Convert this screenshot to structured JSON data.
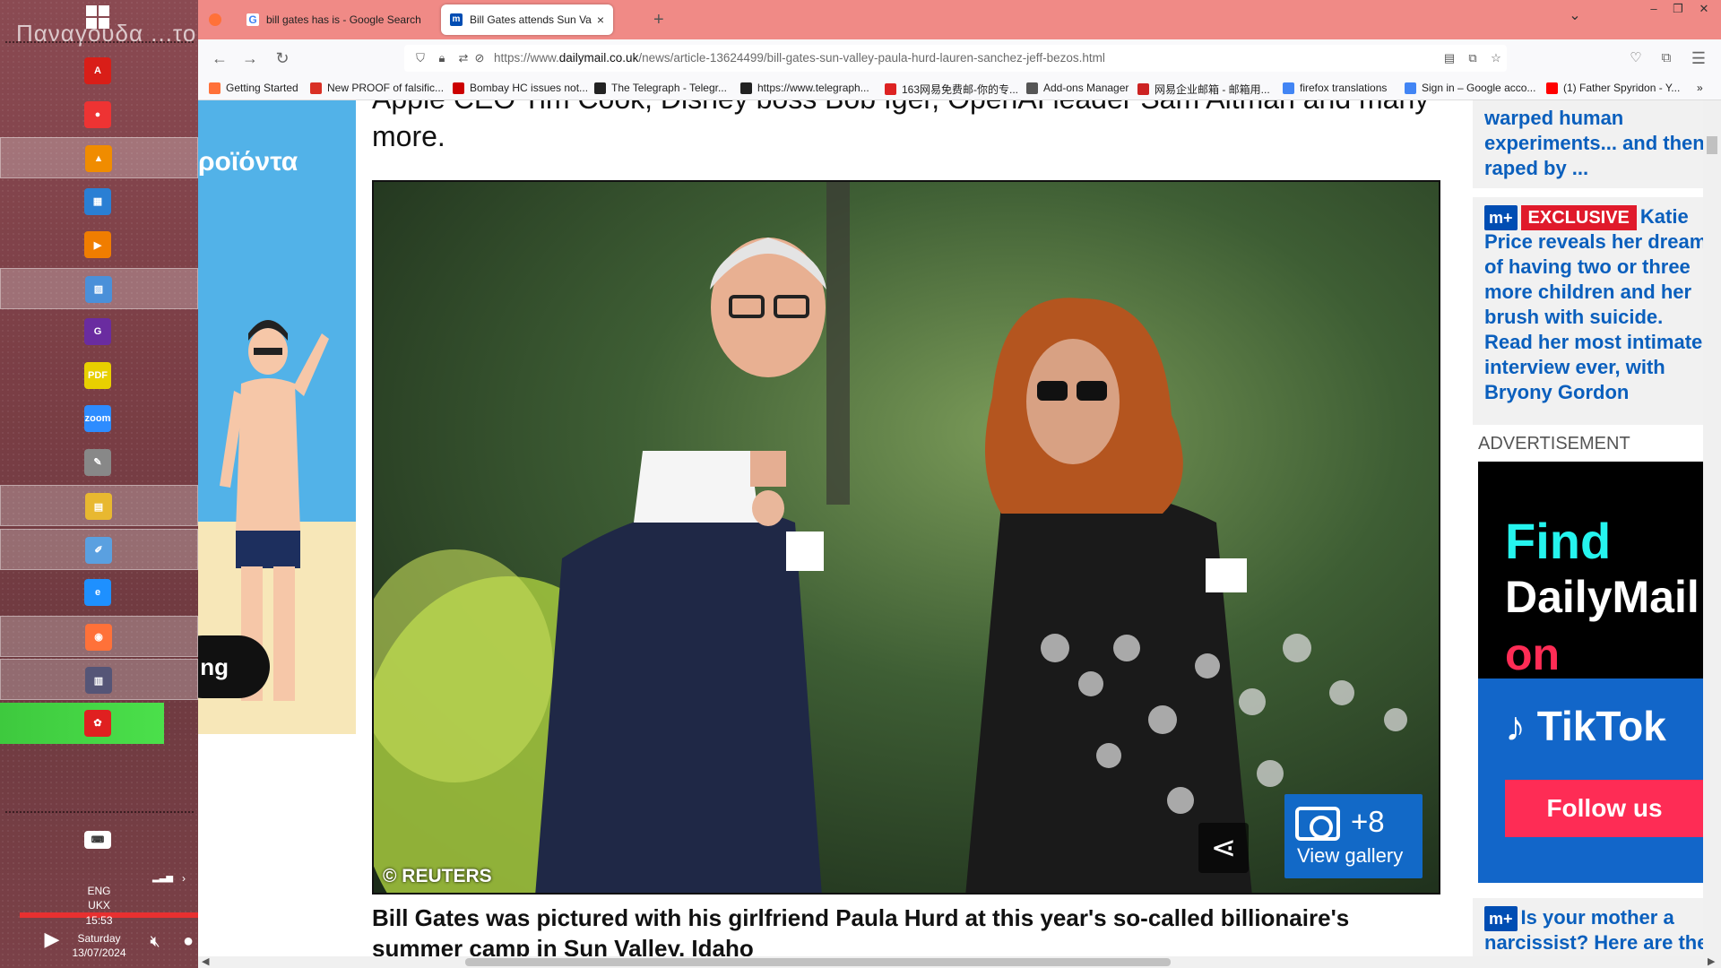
{
  "taskbar": {
    "title": "Παναγουδα ...το",
    "items": [
      {
        "icon": "acrobat-icon",
        "color": "#d91e18",
        "glyph": "A"
      },
      {
        "icon": "paint-bucket-icon",
        "color": "#e33",
        "glyph": "●"
      },
      {
        "icon": "vlc-icon",
        "color": "#f08c00",
        "glyph": "▲"
      },
      {
        "icon": "network-icon",
        "color": "#2a7fd4",
        "glyph": "▦"
      },
      {
        "icon": "media-player-icon",
        "color": "#f07d00",
        "glyph": "▶"
      },
      {
        "icon": "image-viewer-icon",
        "color": "#4a90d9",
        "glyph": "▨"
      },
      {
        "icon": "gpdf-icon",
        "color": "#6a2ca0",
        "glyph": "G"
      },
      {
        "icon": "pdf-tool-icon",
        "color": "#e8d000",
        "glyph": "PDF"
      },
      {
        "icon": "zoom-icon",
        "color": "#2d8cff",
        "glyph": "zoom"
      },
      {
        "icon": "tools-icon",
        "color": "#888",
        "glyph": "✎"
      },
      {
        "icon": "file-manager-icon",
        "color": "#e8b830",
        "glyph": "▤"
      },
      {
        "icon": "editor-icon",
        "color": "#5aa0e0",
        "glyph": "✐"
      },
      {
        "icon": "internet-explorer-icon",
        "color": "#1e90ff",
        "glyph": "e"
      },
      {
        "icon": "firefox-icon",
        "color": "#ff7139",
        "glyph": "◉"
      },
      {
        "icon": "documents-icon",
        "color": "#557",
        "glyph": "▥"
      },
      {
        "icon": "app-red-icon",
        "color": "#e02020",
        "glyph": "✿"
      }
    ],
    "lang": "ENG",
    "layout": "UKX",
    "time": "15:53",
    "day": "Saturday",
    "date": "13/07/2024"
  },
  "browser": {
    "tabs": [
      {
        "title": "bill gates has is - Google Search",
        "close": "×"
      },
      {
        "title": "Bill Gates attends Sun Valley wit",
        "close": "×"
      }
    ],
    "new_tab": "+",
    "url_prefix": "https://www.",
    "url_domain": "dailymail.co.uk",
    "url_path": "/news/article-13624499/bill-gates-sun-valley-paula-hurd-lauren-sanchez-jeff-bezos.html",
    "bookmarks": [
      {
        "label": "Getting Started",
        "color": "#ff7139"
      },
      {
        "label": "New PROOF of falsific...",
        "color": "#d93025"
      },
      {
        "label": "Bombay HC issues not...",
        "color": "#c00"
      },
      {
        "label": "The Telegraph - Telegr...",
        "color": "#222"
      },
      {
        "label": "https://www.telegraph...",
        "color": "#222"
      },
      {
        "label": "163网易免费邮-你的专...",
        "color": "#d22"
      },
      {
        "label": "Add-ons Manager",
        "color": "#555"
      },
      {
        "label": "网易企业邮箱 - 邮箱用...",
        "color": "#c22"
      },
      {
        "label": "firefox translations",
        "color": "#4285f4"
      },
      {
        "label": "Sign in – Google acco...",
        "color": "#4285f4"
      },
      {
        "label": "(1) Father Spyridon - Y...",
        "color": "#f00"
      }
    ]
  },
  "left_ad": {
    "greek_text": "ροϊόντα",
    "pill_text": "ng"
  },
  "article": {
    "lede_line1": "Apple CEO Tim Cook, Disney boss Bob Iger, OpenAI leader Sam Altman and many",
    "lede_line2": "more.",
    "photo_credit": "© REUTERS",
    "gallery_count": "+8",
    "gallery_label": "View gallery",
    "caption_line1": "Bill Gates was pictured with his girlfriend Paula Hurd at this year's so-called billionaire's",
    "caption_line2": "summer camp in Sun Valley, Idaho"
  },
  "sidebar": {
    "card1_lines": [
      "warped human",
      "experiments... and then",
      "raped by ..."
    ],
    "card2_badge_m": "m+",
    "card2_badge_ex": "EXCLUSIVE",
    "card2_lines": [
      "Katie",
      "Price reveals her dream",
      "of having two or three",
      "more children and her",
      "brush with suicide.",
      "Read her most intimate",
      "interview ever, with",
      "Bryony Gordon"
    ],
    "advert_label": "ADVERTISEMENT",
    "ad_find": "Find",
    "ad_brand": "DailyMail",
    "ad_on": "on",
    "ad_tiktok": "TikTok",
    "ad_follow": "Follow us",
    "card3_badge_m": "m+",
    "card3_lines": [
      "Is your mother a",
      "narcissist? Here are the"
    ]
  }
}
